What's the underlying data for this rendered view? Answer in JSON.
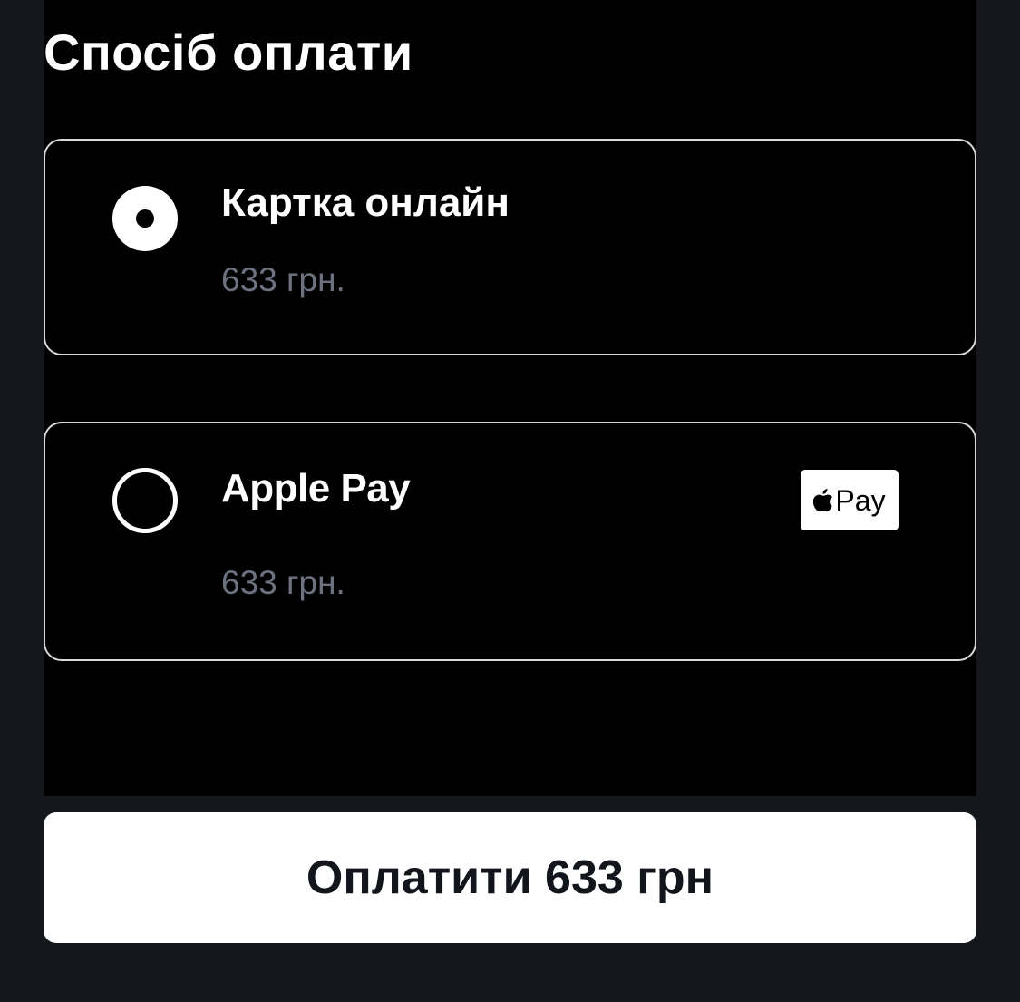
{
  "payment": {
    "title": "Спосіб оплати",
    "options": [
      {
        "label": "Картка онлайн",
        "price": "633 грн.",
        "selected": true
      },
      {
        "label": "Apple Pay",
        "price": "633 грн.",
        "selected": false,
        "badge_text": "Pay"
      }
    ],
    "submit": {
      "label_prefix": "Оплатити ",
      "amount": "633",
      "label_suffix": " грн"
    }
  },
  "colors": {
    "page_background": "#14171c",
    "panel_background": "#000000",
    "text_primary": "#ffffff",
    "text_secondary": "#6d7280",
    "button_background": "#ffffff",
    "button_text": "#12151b"
  },
  "icons": [
    "radio-selected-icon",
    "radio-unselected-icon",
    "apple-logo-icon"
  ]
}
